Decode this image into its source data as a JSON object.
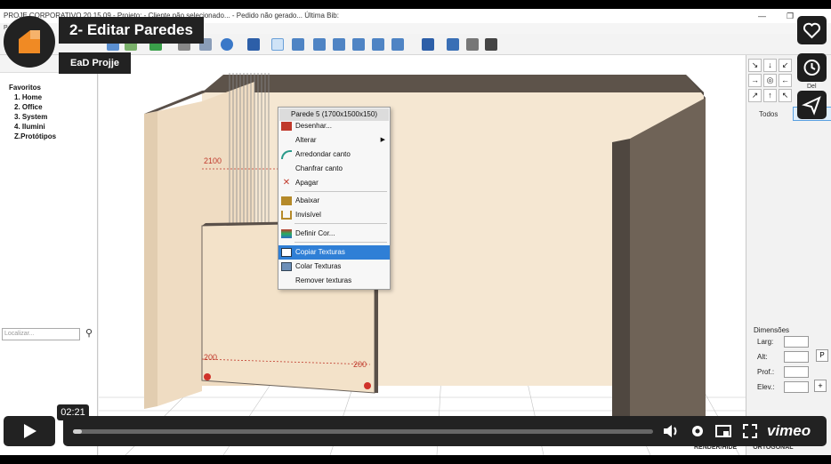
{
  "app": {
    "title_bar": "PROJE CORPORATIVO 20.15.09 - Projeto: - Cliente não selecionado... - Pedido não gerado... Última Bib:",
    "menu_fragment": "P          ção",
    "window_controls": {
      "minimize": "—",
      "restore": "❐",
      "close": "✕"
    }
  },
  "left_panel": {
    "favorites_title": "Favoritos",
    "favorites": [
      "1. Home",
      "2. Office",
      "3. System",
      "4. Ilumini",
      "Z.Protótipos"
    ],
    "search_placeholder": "Localizar..."
  },
  "viewport": {
    "dim_labels": [
      "2100",
      "200",
      "200"
    ],
    "corner_markers": [
      "0",
      "0"
    ]
  },
  "context_menu": {
    "header": "Parede 5 (1700x1500x150)",
    "items": [
      {
        "label": "Desenhar...",
        "icon": "draw-icon",
        "submenu": false,
        "selected": false
      },
      {
        "label": "Alterar",
        "icon": "",
        "submenu": true,
        "selected": false
      },
      {
        "label": "Arredondar canto",
        "icon": "round-corner-icon",
        "submenu": false,
        "selected": false
      },
      {
        "label": "Chanfrar canto",
        "icon": "",
        "submenu": false,
        "selected": false
      },
      {
        "label": "Apagar",
        "icon": "delete-icon",
        "submenu": false,
        "selected": false
      },
      {
        "label": "Abaixar",
        "icon": "lower-icon",
        "submenu": false,
        "selected": false
      },
      {
        "label": "Invisível",
        "icon": "invisible-icon",
        "submenu": false,
        "selected": false
      },
      {
        "label": "Definir Cor...",
        "icon": "color-icon",
        "submenu": false,
        "selected": false
      },
      {
        "label": "Copiar Texturas",
        "icon": "copy-texture-icon",
        "submenu": false,
        "selected": true
      },
      {
        "label": "Colar Texturas",
        "icon": "paste-texture-icon",
        "submenu": false,
        "selected": false
      },
      {
        "label": "Remover texturas",
        "icon": "",
        "submenu": false,
        "selected": false
      }
    ]
  },
  "right_panel": {
    "nav_arrows": [
      "↘",
      "↓",
      "↙",
      "→",
      "◎",
      "←",
      "↗",
      "↑",
      "↖"
    ],
    "del_label": "Del",
    "tab_todos": "Todos",
    "dimensions_title": "Dimensões",
    "dims": [
      "Larg:",
      "Alt:",
      "Prof.:",
      "Elev.:"
    ],
    "p_button": "P",
    "plus_button": "+",
    "bottom_tabs": [
      "RENDER/HIDE",
      "ORTOGONAL"
    ]
  },
  "video": {
    "title": "2- Editar Paredes",
    "author": "EaD Projje",
    "time": "02:21",
    "progress": 0.015,
    "brand": "vimeo",
    "colors": {
      "overlay_bg": "#222222",
      "accent_logo": "#f08a24"
    }
  }
}
